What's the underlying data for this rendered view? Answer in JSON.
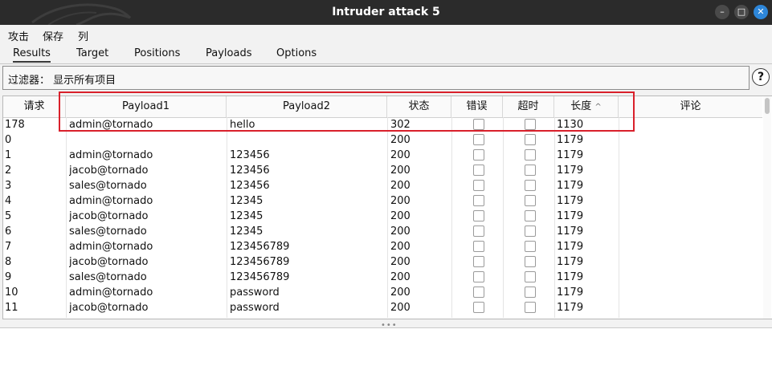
{
  "window": {
    "title": "Intruder attack 5"
  },
  "menu": [
    "攻击",
    "保存",
    "列"
  ],
  "tabs": [
    "Results",
    "Target",
    "Positions",
    "Payloads",
    "Options"
  ],
  "filter": {
    "label": "过滤器：",
    "value": "显示所有项目"
  },
  "help_label": "?",
  "columns": {
    "request": "请求",
    "payload1": "Payload1",
    "payload2": "Payload2",
    "status": "状态",
    "error": "错误",
    "timeout": "超时",
    "length": "长度",
    "length_sort_glyph": "^",
    "comment": "评论"
  },
  "rows": [
    {
      "request": "178",
      "payload1": "admin@tornado",
      "payload2": "hello",
      "status": "302",
      "length": "1130"
    },
    {
      "request": "0",
      "payload1": "",
      "payload2": "",
      "status": "200",
      "length": "1179"
    },
    {
      "request": "1",
      "payload1": "admin@tornado",
      "payload2": "123456",
      "status": "200",
      "length": "1179"
    },
    {
      "request": "2",
      "payload1": "jacob@tornado",
      "payload2": "123456",
      "status": "200",
      "length": "1179"
    },
    {
      "request": "3",
      "payload1": "sales@tornado",
      "payload2": "123456",
      "status": "200",
      "length": "1179"
    },
    {
      "request": "4",
      "payload1": "admin@tornado",
      "payload2": "12345",
      "status": "200",
      "length": "1179"
    },
    {
      "request": "5",
      "payload1": "jacob@tornado",
      "payload2": "12345",
      "status": "200",
      "length": "1179"
    },
    {
      "request": "6",
      "payload1": "sales@tornado",
      "payload2": "12345",
      "status": "200",
      "length": "1179"
    },
    {
      "request": "7",
      "payload1": "admin@tornado",
      "payload2": "123456789",
      "status": "200",
      "length": "1179"
    },
    {
      "request": "8",
      "payload1": "jacob@tornado",
      "payload2": "123456789",
      "status": "200",
      "length": "1179"
    },
    {
      "request": "9",
      "payload1": "sales@tornado",
      "payload2": "123456789",
      "status": "200",
      "length": "1179"
    },
    {
      "request": "10",
      "payload1": "admin@tornado",
      "payload2": "password",
      "status": "200",
      "length": "1179"
    },
    {
      "request": "11",
      "payload1": "jacob@tornado",
      "payload2": "password",
      "status": "200",
      "length": "1179"
    }
  ],
  "colors": {
    "titlebar": "#2b2b2b",
    "close_button": "#2d86d9",
    "highlight": "#d9202b"
  },
  "icons": {
    "minimize": "minimize-icon",
    "maximize": "maximize-icon",
    "close": "close-icon",
    "logo": "kali-dragon-logo"
  }
}
